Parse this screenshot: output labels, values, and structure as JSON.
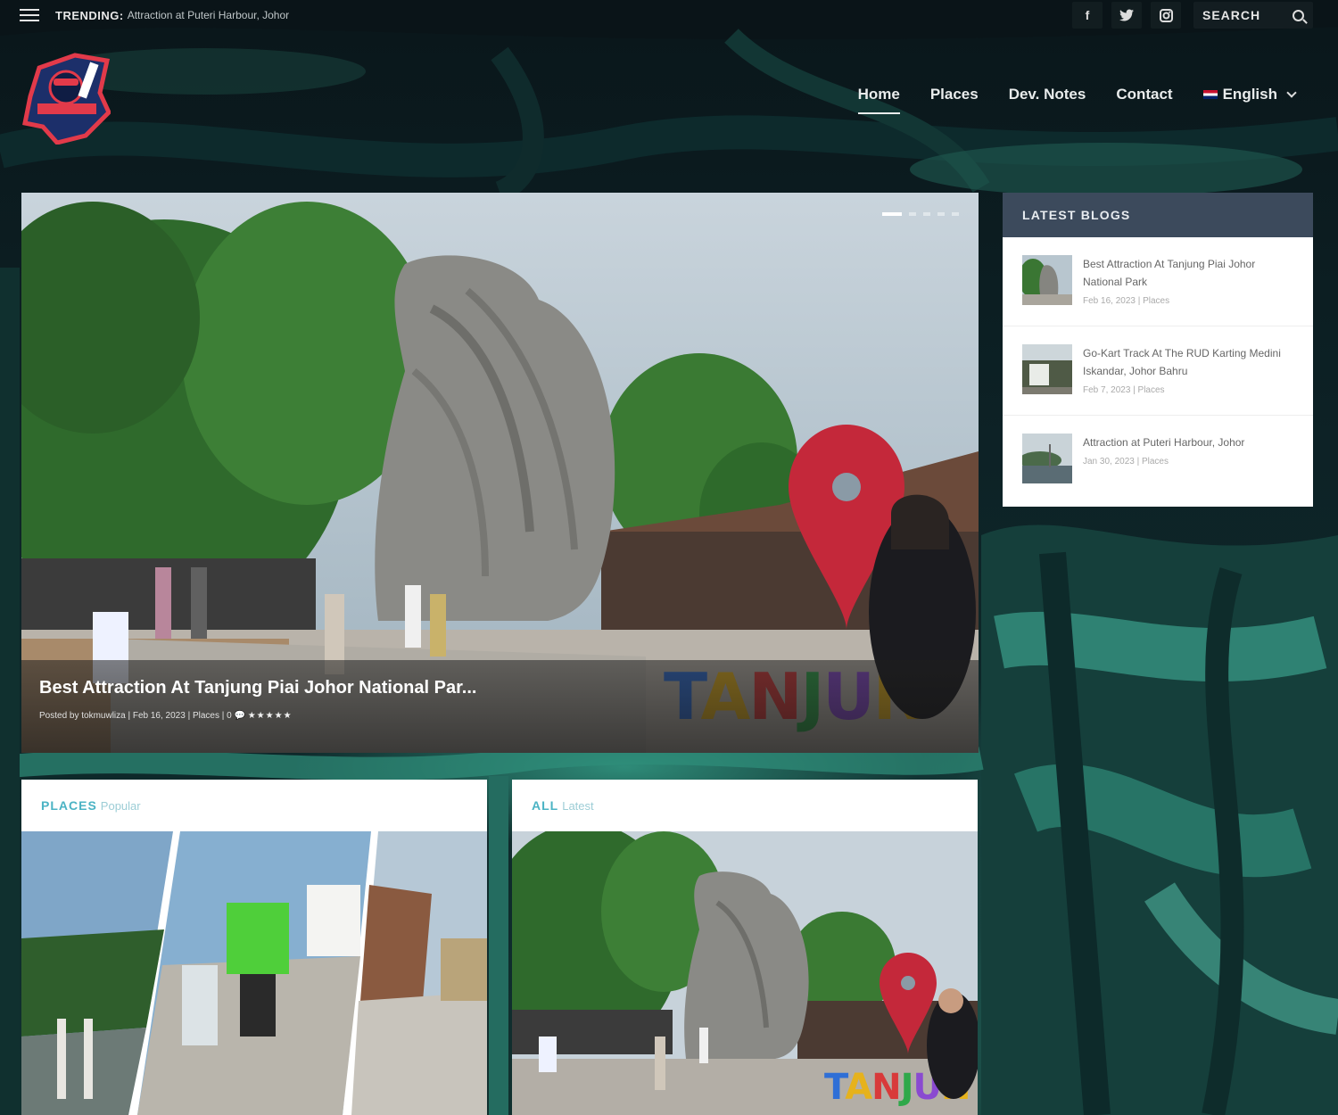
{
  "topbar": {
    "trending_label": "TRENDING:",
    "trending_text": "Attraction at Puteri Harbour, Johor",
    "social": [
      "f",
      "t",
      "ig"
    ],
    "search_placeholder": "SEARCH"
  },
  "nav": {
    "items": [
      "Home",
      "Places",
      "Dev. Notes",
      "Contact"
    ],
    "active": "Home",
    "language": "English"
  },
  "hero": {
    "title": "Best Attraction At Tanjung Piai Johor National Par...",
    "meta": "Posted by tokmuwliza | Feb 16, 2023 | Places | 0",
    "stars": "★★★★★",
    "sign_text": "TANJUN"
  },
  "latest_blogs": {
    "heading": "LATEST BLOGS",
    "items": [
      {
        "title": "Best Attraction At Tanjung Piai Johor National Park",
        "meta": "Feb 16, 2023 | Places"
      },
      {
        "title": "Go-Kart Track At The RUD Karting Medini Iskandar, Johor Bahru",
        "meta": "Feb 7, 2023 | Places"
      },
      {
        "title": "Attraction at Puteri Harbour, Johor",
        "meta": "Jan 30, 2023 | Places"
      }
    ]
  },
  "panels": {
    "places": {
      "label": "PLACES",
      "sub": "Popular"
    },
    "all": {
      "label": "ALL",
      "sub": "Latest",
      "sign_text": "TANJUN"
    }
  },
  "colors": {
    "accent": "#4bb3c4",
    "blogs_header": "#3c4a5c",
    "pin": "#c4283a"
  }
}
